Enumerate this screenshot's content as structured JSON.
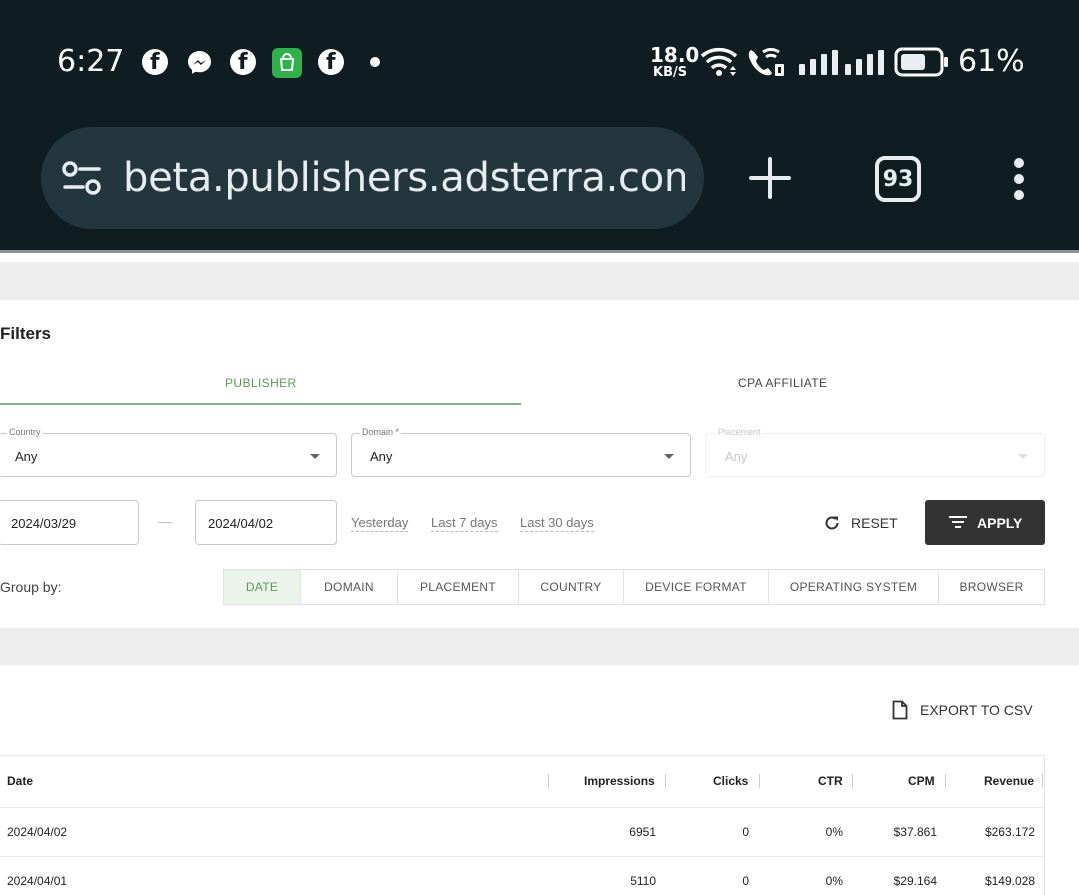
{
  "status": {
    "time": "6:27",
    "speed_value": "18.0",
    "speed_unit": "KB/S",
    "battery": "61%"
  },
  "browser": {
    "url": "beta.publishers.adsterra.com/s",
    "tab_count": "93"
  },
  "filters": {
    "title": "Filters",
    "tabs": [
      {
        "label": "PUBLISHER",
        "active": true
      },
      {
        "label": "CPA AFFILIATE",
        "active": false
      }
    ],
    "country": {
      "label": "Country",
      "value": "Any"
    },
    "domain": {
      "label": "Domain *",
      "value": "Any"
    },
    "placement": {
      "label": "Placement",
      "value": "Any",
      "disabled": true
    },
    "date_from": "2024/03/29",
    "date_separator": "—",
    "date_to": "2024/04/02",
    "quick_ranges": [
      "Yesterday",
      "Last 7 days",
      "Last 30 days"
    ],
    "reset_label": "RESET",
    "apply_label": "APPLY",
    "group_by_label": "Group by:",
    "group_by": [
      "DATE",
      "DOMAIN",
      "PLACEMENT",
      "COUNTRY",
      "DEVICE FORMAT",
      "OPERATING SYSTEM",
      "BROWSER"
    ],
    "group_by_active": "DATE"
  },
  "report": {
    "export_label": "EXPORT TO CSV",
    "columns": [
      "Date",
      "Impressions",
      "Clicks",
      "CTR",
      "CPM",
      "Revenue"
    ],
    "rows": [
      [
        "2024/04/02",
        "6951",
        "0",
        "0%",
        "$37.861",
        "$263.172"
      ],
      [
        "2024/04/01",
        "5110",
        "0",
        "0%",
        "$29.164",
        "$149.028"
      ]
    ]
  },
  "colors": {
    "accent_green": "#5a9b5c",
    "apply_bg": "#333333",
    "statusbar_bg": "#0f1c22"
  }
}
